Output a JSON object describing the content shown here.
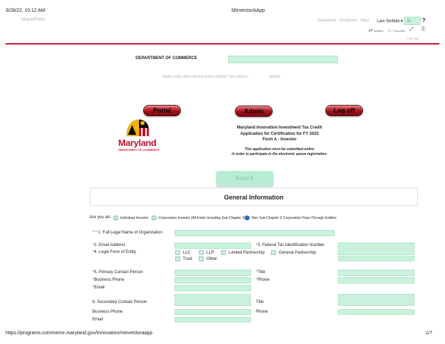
{
  "print_header": {
    "datetime": "3/28/22, 10:12 AM",
    "page_title": "MInvestorAApp"
  },
  "sp_bar": {
    "brand": "SharePoint",
    "nav": [
      "Newsfeed",
      "OneDrive",
      "Sites"
    ],
    "user": "Lani Sinfield",
    "help": "?",
    "share": "SHARE",
    "follow": "FOLLOW",
    "logout": "Log out"
  },
  "dept": {
    "label": "DEPARTMENT OF COMMERCE"
  },
  "subnav": {
    "items": [
      "MARYLAND INNOVATION INVESTMENT TAX CREDIT",
      "ADMIN"
    ]
  },
  "buttons": {
    "portal": "Portal",
    "admin": "Admin",
    "logoff": "Log  off"
  },
  "logo": {
    "name": "Maryland",
    "sub": "DEPARTMENT OF COMMERCE"
  },
  "form_header": {
    "line1": "Maryland Innovation Investment Tax Credit",
    "line2": "Application for Certification for FY  2022",
    "line3": "Form A - Investor",
    "note1": "This application must be submitted online",
    "note2": "in order to participate in the electronic  queue registration."
  },
  "tab": {
    "label": "Form A"
  },
  "section": {
    "title": "General Information"
  },
  "investor_type": {
    "prompt": "Are you an:",
    "options": [
      {
        "label": "Individual Investor",
        "selected": false
      },
      {
        "label": "Corporation Investor (All Kinds Including Sub-Chapter S)",
        "selected": false
      },
      {
        "label": "Non Sub-Chapter S Corporation Pass-Through Entities",
        "selected": true
      }
    ]
  },
  "fields": {
    "legal_name": {
      "req": "* *",
      "label": " 1. Full Legal Name of Organization"
    },
    "email": {
      "req": "*",
      "label": "2. Email Address"
    },
    "fein": {
      "req": "*",
      "label": "3. Federal Tax Identification Number"
    },
    "legal_form": {
      "req": "*",
      "label": "4. Legal Form of Entity"
    },
    "entity_options": [
      "LLC",
      "LLP",
      "Limited Partnership",
      "General Partnership",
      "Trust",
      "Other:"
    ],
    "primary_contact": {
      "req": "*",
      "label": "5. Primary Contact Person"
    },
    "title": {
      "req": "*",
      "label": "Title"
    },
    "business_phone": {
      "req": "*",
      "label": "Business Phone"
    },
    "phone": {
      "req": "*",
      "label": "Phone"
    },
    "primary_email": {
      "req": "*",
      "label": "Email"
    },
    "secondary_contact": {
      "label": "6. Secondary Contact Person"
    },
    "secondary_title": {
      "label": "Title"
    },
    "secondary_business_phone": {
      "label": "Business Phone"
    },
    "secondary_phone": {
      "label": "Phone"
    },
    "secondary_email": {
      "label": "Email"
    }
  },
  "print_footer": {
    "url": "https://programs.commerce.maryland.gov/Innovation/minvestoraapp",
    "page": "1/7"
  },
  "colors": {
    "field": "#c9f2dc",
    "divider": "#c8102e",
    "button": "#a8121c"
  }
}
